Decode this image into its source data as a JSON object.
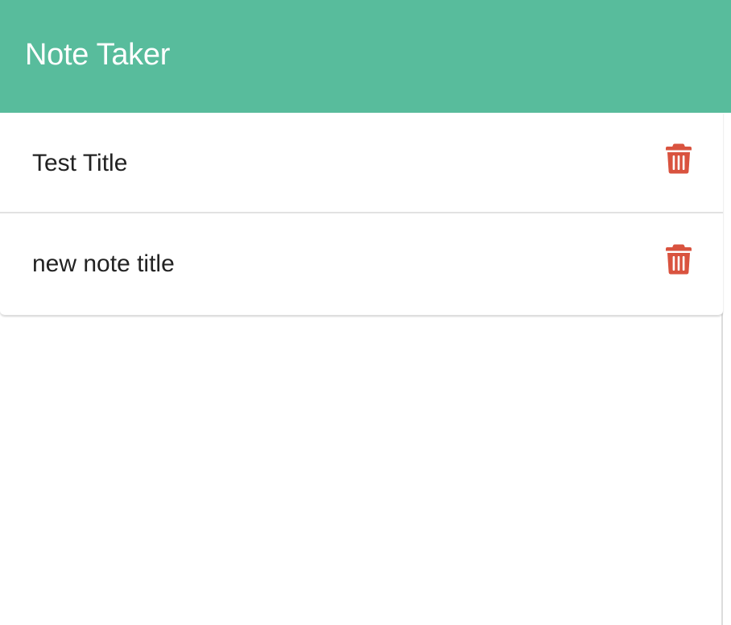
{
  "header": {
    "title": "Note Taker"
  },
  "notes": [
    {
      "title": "Test Title",
      "delete_icon": "trash-icon"
    },
    {
      "title": "new note title",
      "delete_icon": "trash-icon"
    }
  ],
  "colors": {
    "header_bg": "#58bc9c",
    "delete_icon": "#d9533f",
    "text": "#222222"
  }
}
